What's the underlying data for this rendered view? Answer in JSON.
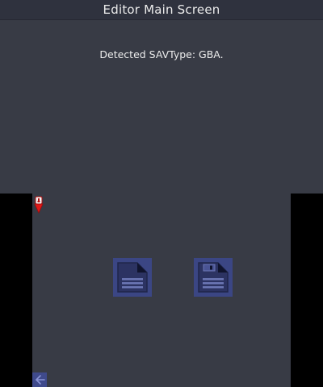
{
  "top_screen": {
    "title": "Editor Main Screen",
    "status": "Detected SAVType: GBA."
  },
  "bottom_screen": {
    "buttons": [
      {
        "icon": "document-icon"
      },
      {
        "icon": "save-disk-icon"
      }
    ],
    "back_icon": "back-arrow-icon",
    "indicator_icon": "battery-icon"
  },
  "colors": {
    "panel_background": "#383b45",
    "title_bar": "#2f323e",
    "button_fill": "#3b4684",
    "outside_background": "#000000",
    "indicator_red": "#e01818"
  }
}
